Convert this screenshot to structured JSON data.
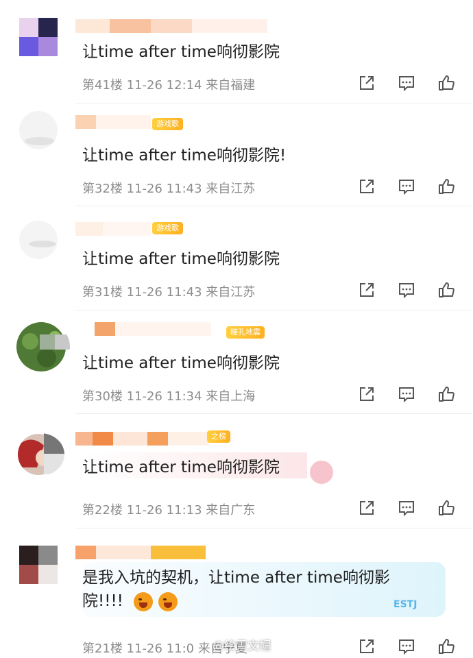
{
  "comments": [
    {
      "text": "让time after time响彻影院",
      "floor": "第41楼",
      "time": "11-26 12:14",
      "location": "来自福建"
    },
    {
      "text": "让time after time响彻影院!",
      "floor": "第32楼",
      "time": "11-26 11:43",
      "location": "来自江苏",
      "badge": "游戏歌"
    },
    {
      "text": "让time after time响彻影院",
      "floor": "第31楼",
      "time": "11-26 11:43",
      "location": "来自江苏",
      "badge": "游戏歌"
    },
    {
      "text": "让time after time响彻影院",
      "floor": "第30楼",
      "time": "11-26 11:34",
      "location": "来自上海",
      "badge": "瞳孔地震"
    },
    {
      "text": "让time after time响彻影院",
      "floor": "第22楼",
      "time": "11-26 11:13",
      "location": "来自广东",
      "badge": "之榜"
    },
    {
      "text": "是我入坑的契机，让time after time响彻影院!!!!",
      "floor": "第21楼",
      "time": "11-26 11:0",
      "location": "来自宁夏"
    }
  ],
  "watermark": "@绘雪文帽",
  "deco_label": "ESTJ",
  "icons": {
    "share": "share-icon",
    "comment": "comment-icon",
    "like": "like-icon"
  },
  "colors": {
    "meta": "#8c8c8c",
    "badge": "#ffbb22",
    "divider": "#eeeeee"
  }
}
